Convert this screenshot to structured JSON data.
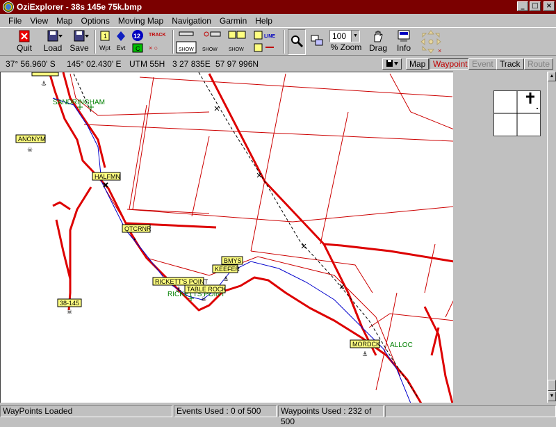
{
  "window": {
    "title": "OziExplorer - 38s 145e 75k.bmp",
    "min": "_",
    "max": "□",
    "close": "×"
  },
  "menu": [
    "File",
    "View",
    "Map",
    "Options",
    "Moving Map",
    "Navigation",
    "Garmin",
    "Help"
  ],
  "toolbar": {
    "quit": "Quit",
    "load": "Load",
    "save": "Save",
    "wpt": "Wpt",
    "evt": "Evt",
    "badge_12": "12",
    "track": "TRACK",
    "show": "SHOW",
    "line": "LINE",
    "zoom_value": "100",
    "zoom_label": "% Zoom",
    "drag": "Drag",
    "info": "Info"
  },
  "position": {
    "lat": "37° 56.960' S",
    "lon": "145° 02.430' E",
    "utm": "UTM  55H",
    "easting": "3 27 835E",
    "northing": "57 97 996N"
  },
  "view_tabs": {
    "map": "Map",
    "waypoint": "Waypoint",
    "event": "Event",
    "track": "Track",
    "route": "Route"
  },
  "waypoints": [
    "ANONYM",
    "HALFMN",
    "QTCRNR",
    "BMYS",
    "KEEFER",
    "RICKETT'S POINT",
    "TABLE ROCK",
    "38-145",
    "MORDCK",
    "SANDRINGHAM",
    "RICKETTS POINT",
    "ALLOC",
    "SANDRINGHAM"
  ],
  "statusbar": {
    "msg": "WayPoints Loaded",
    "events": "Events Used :  0 of 500",
    "waypoints": "Waypoints Used :  232 of 500"
  },
  "colors": {
    "title_bg": "#7b0000",
    "grid_red": "#cc0000",
    "road_red": "#dd0000",
    "coast_blue": "#0000cc",
    "waypoint_bg": "#ffff80",
    "label_green": "#008000"
  }
}
